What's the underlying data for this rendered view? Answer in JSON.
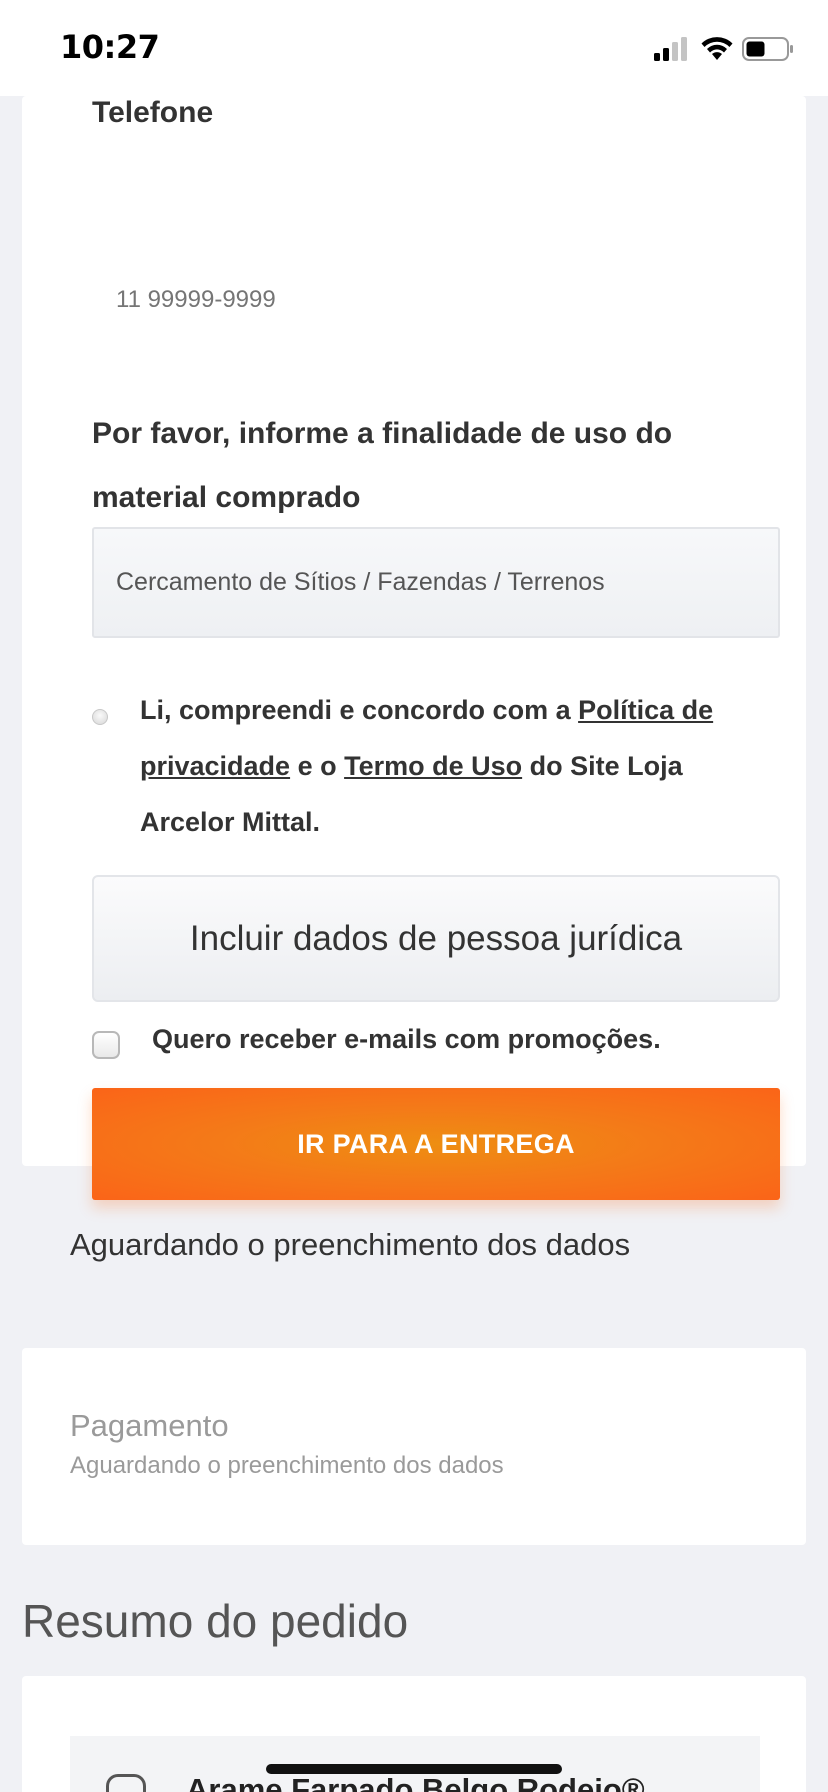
{
  "status_bar": {
    "time": "10:27"
  },
  "form": {
    "phone_label": "Telefone",
    "phone_placeholder": "11 99999-9999",
    "purpose_label": "Por favor, informe a finalidade de uso do material comprado",
    "purpose_selected": "Cercamento de Sítios / Fazendas / Terrenos",
    "privacy": {
      "prefix": "Li, compreendi e concordo com a ",
      "privacy_link": "Política de privacidade",
      "middle": " e o ",
      "terms_link": "Termo de Uso",
      "suffix": " do Site Loja Arcelor Mittal."
    },
    "pj_button": "Incluir dados de pessoa jurídica",
    "promo_label": "Quero receber e-mails com promoções.",
    "promo_checked": false,
    "cta_button": "IR PARA A ENTREGA"
  },
  "delivery_waiting": "Aguardando o preenchimento dos dados",
  "payment": {
    "title": "Pagamento",
    "subtitle": "Aguardando o preenchimento dos dados"
  },
  "summary": {
    "title": "Resumo do pedido",
    "product_name": "Arame Farpado Belgo Rodeio®"
  },
  "colors": {
    "accent": "#f47a18",
    "background": "#f0f1f5"
  }
}
